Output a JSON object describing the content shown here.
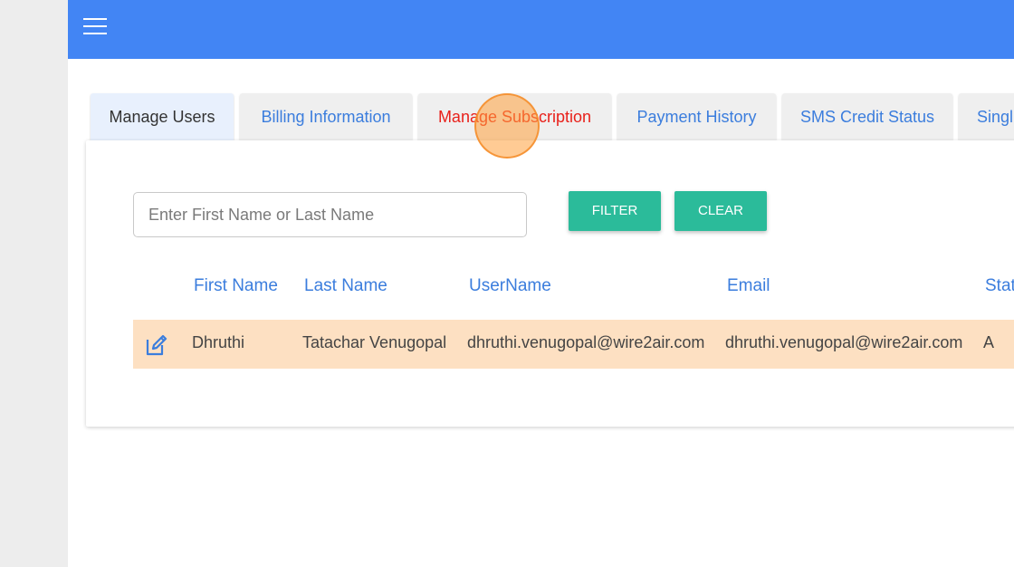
{
  "header": {
    "menu_icon": "hamburger-menu-icon",
    "background_color": "#4285f4"
  },
  "tabs": [
    {
      "label": "Manage Users",
      "active": true
    },
    {
      "label": "Billing Information"
    },
    {
      "label": "Manage Subscription",
      "highlighted": true
    },
    {
      "label": "Payment History"
    },
    {
      "label": "SMS Credit Status"
    },
    {
      "label": "Singl"
    }
  ],
  "filter": {
    "placeholder": "Enter First Name or Last Name",
    "value": "",
    "filter_label": "FILTER",
    "clear_label": "CLEAR"
  },
  "table": {
    "columns": [
      "First Name",
      "Last Name",
      "UserName",
      "Email",
      "Stat"
    ],
    "rows": [
      {
        "first_name": "Dhruthi",
        "last_name": "Tatachar Venugopal",
        "username": "dhruthi.venugopal@wire2air.com",
        "email": "dhruthi.venugopal@wire2air.com",
        "status": "A"
      }
    ]
  },
  "colors": {
    "accent": "#4285f4",
    "button": "#2bbb9a",
    "link": "#3b7ddd",
    "highlight_tab": "#e8211b",
    "row_highlight": "#fde0c2"
  }
}
